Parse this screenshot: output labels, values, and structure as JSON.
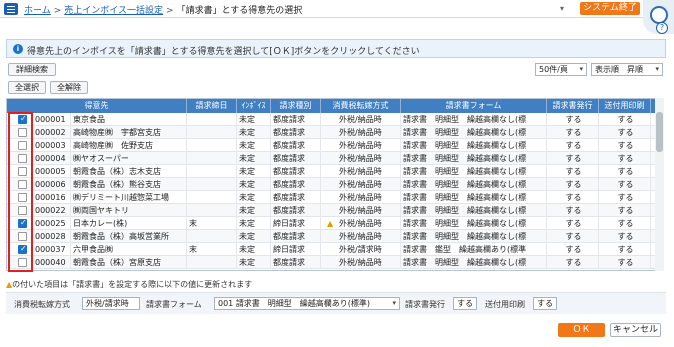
{
  "header": {
    "breadcrumb": [
      "ホーム",
      "売上インボイス一括設定",
      "「請求書」とする得意先の選択"
    ],
    "separator": ">",
    "system_exit": "システム終了",
    "help": "?"
  },
  "info_message": "得意先上のインボイスを「請求書」とする得意先を選択して[ＯＫ]ボタンをクリックしてください",
  "toolbar": {
    "detail_search": "詳細検索",
    "select_all": "全選択",
    "deselect_all": "全解除",
    "per_page": "50件/頁",
    "display_order": "表示順　昇順"
  },
  "table": {
    "columns": [
      "得意先",
      "請求締日",
      "ｲﾝﾎﾞｲｽ",
      "請求種別",
      "消費税転嫁方式",
      "請求書フォーム",
      "請求書発行",
      "送付用印刷"
    ],
    "rows": [
      {
        "checked": true,
        "code": "000001",
        "name": "東京食品",
        "closing": "",
        "invoice": "未定",
        "type": "都度請求",
        "warn": false,
        "tax": "外税/納品時",
        "form": "請求書　明細型　繰越高欄なし(標",
        "issue": "する",
        "print": "する"
      },
      {
        "checked": false,
        "code": "000002",
        "name": "高崎物産㈱　宇都宮支店",
        "closing": "",
        "invoice": "未定",
        "type": "都度請求",
        "warn": false,
        "tax": "外税/納品時",
        "form": "請求書　明細型　繰越高欄なし(標",
        "issue": "する",
        "print": "する"
      },
      {
        "checked": false,
        "code": "000003",
        "name": "高崎物産㈱　佐野支店",
        "closing": "",
        "invoice": "未定",
        "type": "都度請求",
        "warn": false,
        "tax": "外税/納品時",
        "form": "請求書　明細型　繰越高欄なし(標",
        "issue": "する",
        "print": "する"
      },
      {
        "checked": false,
        "code": "000004",
        "name": "㈱ヤオスーパー",
        "closing": "",
        "invoice": "未定",
        "type": "都度請求",
        "warn": false,
        "tax": "外税/納品時",
        "form": "請求書　明細型　繰越高欄なし(標",
        "issue": "する",
        "print": "する"
      },
      {
        "checked": false,
        "code": "000005",
        "name": "朝霞食品（株）志木支店",
        "closing": "",
        "invoice": "未定",
        "type": "都度請求",
        "warn": false,
        "tax": "外税/納品時",
        "form": "請求書　明細型　繰越高欄なし(標",
        "issue": "する",
        "print": "する"
      },
      {
        "checked": false,
        "code": "000006",
        "name": "朝霞食品（株）熊谷支店",
        "closing": "",
        "invoice": "未定",
        "type": "都度請求",
        "warn": false,
        "tax": "外税/納品時",
        "form": "請求書　明細型　繰越高欄なし(標",
        "issue": "する",
        "print": "する"
      },
      {
        "checked": false,
        "code": "000016",
        "name": "㈱デリミート川越惣菜工場",
        "closing": "",
        "invoice": "未定",
        "type": "都度請求",
        "warn": false,
        "tax": "外税/納品時",
        "form": "請求書　明細型　繰越高欄なし(標",
        "issue": "する",
        "print": "する"
      },
      {
        "checked": false,
        "code": "000022",
        "name": "㈱両国ヤキトリ",
        "closing": "",
        "invoice": "未定",
        "type": "都度請求",
        "warn": false,
        "tax": "外税/納品時",
        "form": "請求書　明細型　繰越高欄なし(標",
        "issue": "する",
        "print": "する"
      },
      {
        "checked": true,
        "code": "000025",
        "name": "日本カレー(株)",
        "closing": "末",
        "invoice": "未定",
        "type": "締日請求",
        "warn": true,
        "tax": "外税/納品時",
        "form": "請求書　明細型　繰越高欄なし(標",
        "issue": "する",
        "print": "する"
      },
      {
        "checked": false,
        "code": "000028",
        "name": "朝霞食品（株）高坂営業所",
        "closing": "",
        "invoice": "未定",
        "type": "都度請求",
        "warn": false,
        "tax": "外税/納品時",
        "form": "請求書　明細型　繰越高欄なし(標",
        "issue": "する",
        "print": "する"
      },
      {
        "checked": true,
        "code": "000037",
        "name": "六甲食品㈱",
        "closing": "末",
        "invoice": "未定",
        "type": "締日請求",
        "warn": false,
        "tax": "外税/請求時",
        "form": "請求書　鑑型　繰越高欄あり(標準",
        "issue": "する",
        "print": "する"
      },
      {
        "checked": false,
        "code": "000040",
        "name": "朝霞食品（株）宮原支店",
        "closing": "",
        "invoice": "未定",
        "type": "都度請求",
        "warn": false,
        "tax": "外税/納品時",
        "form": "請求書　明細型　繰越高欄なし(標",
        "issue": "する",
        "print": "する"
      }
    ]
  },
  "note": "の付いた項目は「請求書」を設定する際に以下の値に更新されます",
  "bottom": {
    "tax_label": "消費税転嫁方式",
    "tax_value": "外税/請求時",
    "form_label": "請求書フォーム",
    "form_value": "001 請求書　明細型　繰越高欄あり(標準)",
    "issue_label": "請求書発行",
    "issue_value": "する",
    "print_label": "送付用印刷",
    "print_value": "する"
  },
  "buttons": {
    "ok": "ＯＫ",
    "cancel": "キャンセル"
  },
  "colors": {
    "accent": "#f07818",
    "header": "#3f7fc2",
    "link": "#1a5fb4",
    "highlight": "#e02020"
  }
}
